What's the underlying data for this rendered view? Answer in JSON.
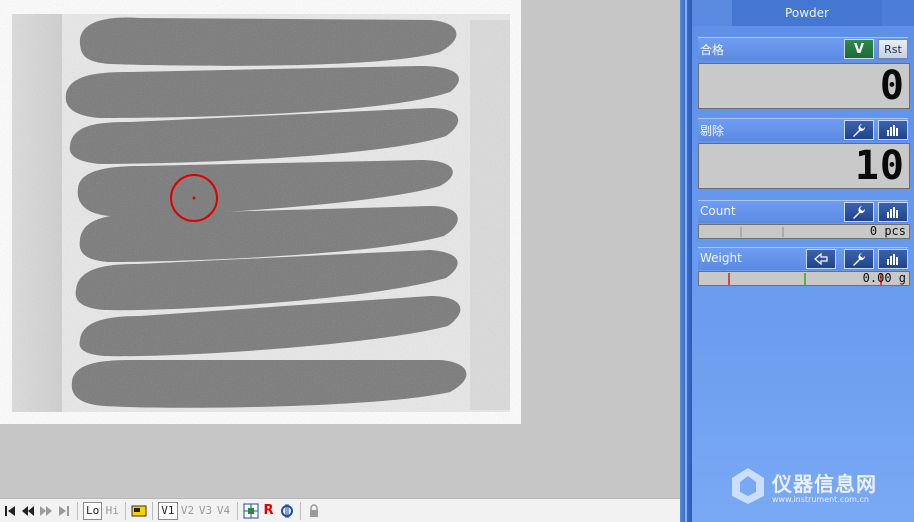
{
  "panel": {
    "title": "Powder",
    "sections": {
      "pass": {
        "label": "合格",
        "v_button": "V",
        "reset_button": "Rst",
        "value": "0"
      },
      "reject": {
        "label": "剔除",
        "value": "10"
      },
      "count": {
        "label": "Count",
        "value": "0 pcs"
      },
      "weight": {
        "label": "Weight",
        "value": "0.00 g"
      }
    }
  },
  "toolbar": {
    "lo": "Lo",
    "hi": "Hi",
    "v1": "V1",
    "v2": "V2",
    "v3": "V3",
    "v4": "V4",
    "r": "R"
  },
  "watermark": {
    "text": "仪器信息网",
    "url": "www.instrument.com.cn"
  },
  "colors": {
    "panel_blue": "#6a9cef",
    "marker_red": "#e00000"
  },
  "icons": [
    "first-icon",
    "rewind-icon",
    "fast-forward-icon",
    "last-icon",
    "image-icon",
    "grid-icon",
    "settings-icon",
    "lock-icon",
    "wrench-icon",
    "histogram-icon",
    "arrow-left-icon"
  ]
}
